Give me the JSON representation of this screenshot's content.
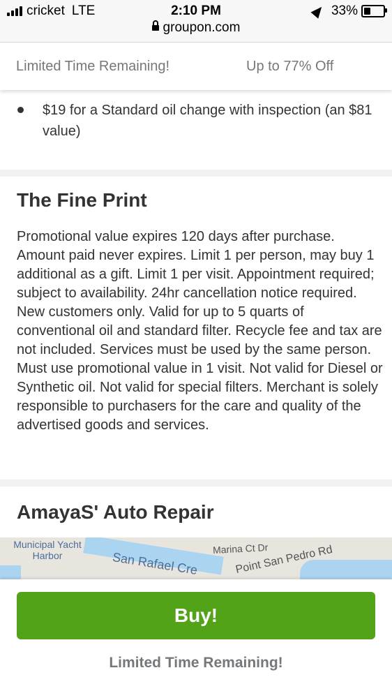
{
  "status": {
    "carrier": "cricket",
    "network": "LTE",
    "time": "2:10 PM",
    "url": "groupon.com",
    "battery": "33%",
    "battery_level": 0.33
  },
  "deal_bar": {
    "left": "Limited Time Remaining!",
    "right": "Up to 77% Off"
  },
  "options": [
    "$19 for a Standard oil change with inspection (an $81 value)"
  ],
  "fine_print": {
    "title": "The Fine Print",
    "text": "Promotional value expires 120 days after purchase. Amount paid never expires. Limit 1 per person, may buy 1 additional as a gift. Limit 1 per visit. Appointment required; subject to availability. 24hr cancellation notice required. New customers only. Valid for up to 5 quarts of conventional oil and standard filter. Recycle fee and tax are not included. Services must be used by the same person. Must use promotional value in 1 visit. Not valid for Diesel or Synthetic oil. Not valid for special filters. Merchant is solely responsible to purchasers for the care and quality of the advertised goods and services."
  },
  "merchant": {
    "name": "AmayaS' Auto Repair"
  },
  "map": {
    "labels": {
      "harbor": "Municipal Yacht Harbor",
      "creek": "San Rafael Cre",
      "marina": "Marina Ct Dr",
      "road": "Point San Pedro Rd"
    }
  },
  "footer": {
    "buy_label": "Buy!",
    "note": "Limited Time Remaining!"
  },
  "colors": {
    "buy_green": "#53a318",
    "muted_text": "#75787b"
  }
}
